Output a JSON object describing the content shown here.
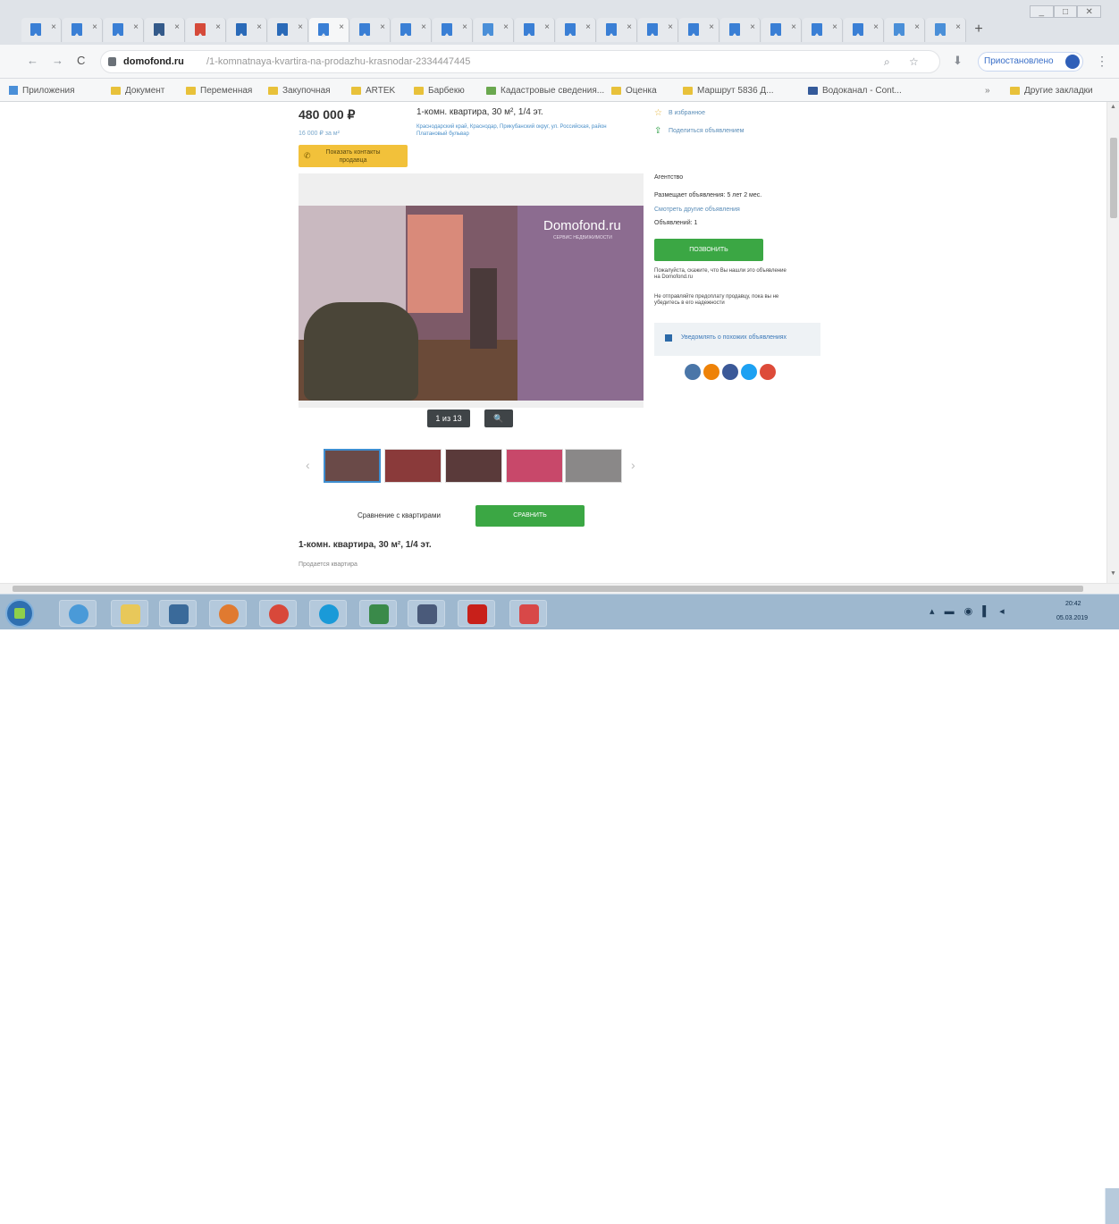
{
  "browser": {
    "new_tab_label": "+",
    "window_controls": [
      "_",
      "□",
      "✕"
    ],
    "address": {
      "domain": "domofond.ru",
      "path": "/1-komnatnaya-kvartira-na-prodazhu-krasnodar-2334447445"
    },
    "signin_label": "Приостановлено",
    "menu_label": "⋮"
  },
  "bookmarks": [
    {
      "label": "Приложения"
    },
    {
      "label": "Документ"
    },
    {
      "label": "Переменная"
    },
    {
      "label": "Закупочная"
    },
    {
      "label": "ARTEK"
    },
    {
      "label": "Барбекю"
    },
    {
      "label": "Кадастровые сведения..."
    },
    {
      "label": "Оценка"
    },
    {
      "label": "Маршрут 5836 Д..."
    },
    {
      "label": "Водоканал - Cont..."
    },
    {
      "label": "Другие закладки"
    }
  ],
  "listing": {
    "price": "480 000 ₽",
    "price_per_m": "16 000 ₽ за м²",
    "contact_button": "Показать контакты продавца",
    "title": "1-комн. квартира, 30 м², 1/4 эт.",
    "address": "Краснодарский край, Краснодар, Прикубанский округ, ул. Российская, район Платановый бульвар",
    "favorite_link": "В избранное",
    "share_link": "Поделиться объявлением",
    "photo_watermark": "Domofond.ru",
    "photo_watermark_sub": "СЕРВИС НЕДВИЖИМОСТИ",
    "photo_count": "1 из 13",
    "zoom_icon": "🔍",
    "compare_label": "Сравнение с квартирами",
    "compare_button": "СРАВНИТЬ",
    "desc_title": "1-комн. квартира, 30 м², 1/4 эт.",
    "desc_sub": "Продается квартира"
  },
  "seller": {
    "type": "Агентство",
    "since": "Размещает объявления: 5 лет 2 мес.",
    "link": "Смотреть другие объявления",
    "count": "Объявлений: 1",
    "call_button": "ПОЗВОНИТЬ",
    "note1": "Пожалуйста, скажите, что Вы нашли это объявление на Domofond.ru",
    "note2": "Не отправляйте предоплату продавцу, пока вы не убедитесь в его надежности",
    "fav_label": "Уведомлять о похожих объявлениях"
  },
  "social": [
    {
      "name": "vk-icon",
      "color": "#4a76a8"
    },
    {
      "name": "ok-icon",
      "color": "#ee8208"
    },
    {
      "name": "facebook-icon",
      "color": "#3b5998"
    },
    {
      "name": "twitter-icon",
      "color": "#1da1f2"
    },
    {
      "name": "google-icon",
      "color": "#dd4b39"
    }
  ],
  "taskbar": {
    "clock_time": "20:42",
    "clock_date": "05.03.2019"
  }
}
